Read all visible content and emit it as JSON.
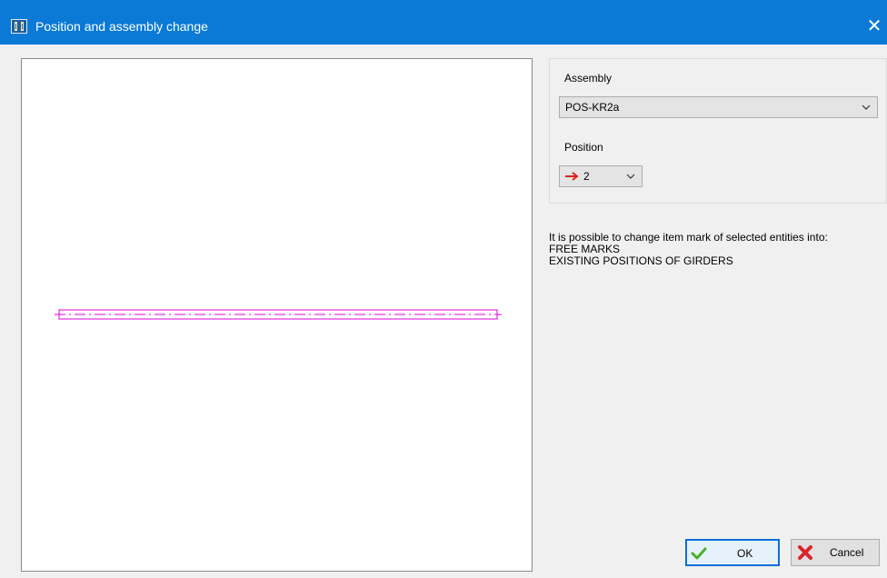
{
  "window": {
    "title": "Position and assembly change",
    "app_icon": "girder-app-icon",
    "close_icon": "close-icon",
    "titlebar_color": "#0a7ad6"
  },
  "assembly": {
    "label": "Assembly",
    "selected": "POS-KR2a"
  },
  "position": {
    "label": "Position",
    "selected": "2",
    "arrow_color": "#e0201b"
  },
  "info": {
    "lines": [
      "It is possible to change item mark of selected entities into:",
      "FREE MARKS",
      "EXISTING POSITIONS OF GIRDERS"
    ]
  },
  "buttons": {
    "ok": {
      "label": "OK",
      "icon": "checkmark-icon",
      "icon_color": "#4caf2a"
    },
    "cancel": {
      "label": "Cancel",
      "icon": "red-x-icon",
      "icon_color": "#d9262c"
    }
  },
  "preview": {
    "element_color": "#e000e0"
  }
}
